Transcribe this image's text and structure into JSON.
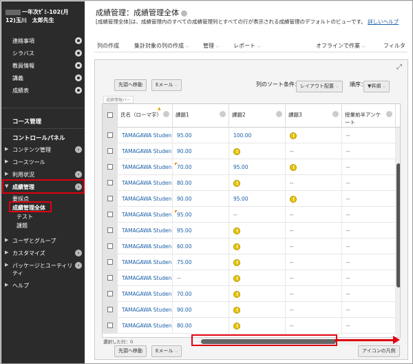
{
  "sidebar": {
    "course_title_line1": "一年次ｾﾞﾐ-102(月",
    "course_title_line2": "12)玉川　太郎先生",
    "nav_items": [
      {
        "label": "連絡事項"
      },
      {
        "label": "シラバス"
      },
      {
        "label": "教員情報"
      },
      {
        "label": "講義"
      },
      {
        "label": "成績表"
      }
    ],
    "course_management": "コース管理",
    "control_panel": "コントロールパネル",
    "tree_items": [
      {
        "label": "コンテンツ管理",
        "arrow": "▶"
      },
      {
        "label": "コースツール",
        "arrow": "▶"
      },
      {
        "label": "利用状況",
        "arrow": "▶"
      },
      {
        "label": "成績管理",
        "arrow": "▼"
      }
    ],
    "grade_sub_items": [
      "要採点",
      "成績管理全体",
      "テスト",
      "課題"
    ],
    "lower_items": [
      {
        "label": "ユーザとグループ",
        "arrow": "▶"
      },
      {
        "label": "カスタマイズ",
        "arrow": "▶"
      },
      {
        "label": "パッケージとユーティリティ",
        "arrow": "▶"
      },
      {
        "label": "ヘルプ",
        "arrow": "▶"
      }
    ]
  },
  "header": {
    "title": "成績管理：成績管理全体",
    "description": "[成績管理全体]は、成績管理内のすべての成績管理列とすべての行が表示される成績管理のデフォルトのビューです。",
    "help_link": "詳しいヘルプ"
  },
  "toolbar": {
    "create_column": "列の作成",
    "create_calc": "集計対象の列の作成",
    "manage": "管理",
    "reports": "レポート",
    "offline": "オフラインで作業",
    "filter": "フィルタ"
  },
  "grid_controls": {
    "move_top": "先頭へ移動",
    "email": "Eメール",
    "sort_label": "列のソート条件：",
    "sort_value": "レイアウト配置",
    "order_label": "順序：",
    "order_value": "▼昇順",
    "info_bar": "成績情報バー",
    "selected_rows": "選択した行：0",
    "icon_legend": "アイコンの凡例"
  },
  "columns": {
    "name": "氏名（ローマ字）",
    "task1": "課題1",
    "task2": "課題2",
    "task3": "課題3",
    "survey": "授業前半アンケート"
  },
  "rows": [
    {
      "name": "TAMAGAWA Studen",
      "t1": "95.00",
      "t2": "100.00",
      "t3": "attempt",
      "s": "--",
      "flag": false
    },
    {
      "name": "TAMAGAWA Studen",
      "t1": "90.00",
      "t2": "attempt",
      "t3": "--",
      "s": "--",
      "flag": false
    },
    {
      "name": "TAMAGAWA Studen",
      "t1": "70.00",
      "t2": "95.00",
      "t3": "attempt",
      "s": "--",
      "flag": true
    },
    {
      "name": "TAMAGAWA Studen",
      "t1": "80.00",
      "t2": "attempt",
      "t3": "--",
      "s": "--",
      "flag": false
    },
    {
      "name": "TAMAGAWA Studen",
      "t1": "90.00",
      "t2": "95.00",
      "t3": "attempt",
      "s": "--",
      "flag": false
    },
    {
      "name": "TAMAGAWA Studen",
      "t1": "95.00",
      "t2": "--",
      "t3": "--",
      "s": "--",
      "flag": true
    },
    {
      "name": "TAMAGAWA Studen",
      "t1": "95.00",
      "t2": "attempt",
      "t3": "--",
      "s": "--",
      "flag": false
    },
    {
      "name": "TAMAGAWA Studen",
      "t1": "60.00",
      "t2": "attempt",
      "t3": "--",
      "s": "--",
      "flag": false
    },
    {
      "name": "TAMAGAWA Studen",
      "t1": "75.00",
      "t2": "attempt",
      "t3": "--",
      "s": "--",
      "flag": false
    },
    {
      "name": "TAMAGAWA Studen",
      "t1": "--",
      "t2": "attempt",
      "t3": "--",
      "s": "--",
      "flag": false
    },
    {
      "name": "TAMAGAWA Studen",
      "t1": "70.00",
      "t2": "attempt",
      "t3": "--",
      "s": "--",
      "flag": false
    },
    {
      "name": "TAMAGAWA Studen",
      "t1": "90.00",
      "t2": "attempt",
      "t3": "--",
      "s": "--",
      "flag": false
    },
    {
      "name": "TAMAGAWA Studen",
      "t1": "80.00",
      "t2": "attempt",
      "t3": "--",
      "s": "--",
      "flag": false
    }
  ],
  "colors": {
    "accent_red": "#e0000f",
    "link_blue": "#1a5fa8",
    "sidebar_bg": "#2b2b2b",
    "attempt_yellow": "#e6c300"
  }
}
